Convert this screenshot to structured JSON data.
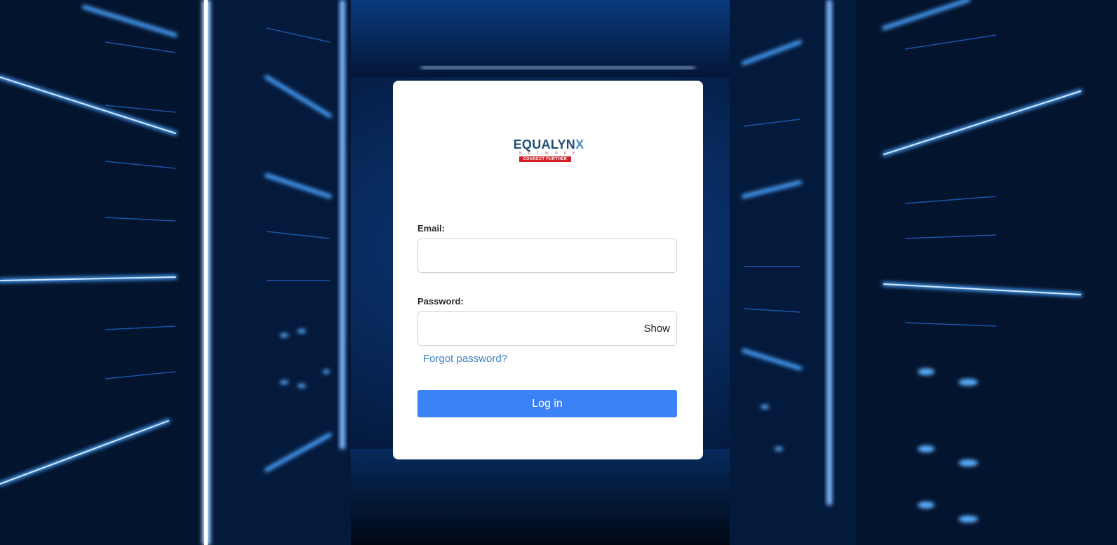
{
  "brand": {
    "name_main": "EQUALYN",
    "name_x": "X",
    "subline": "NETWORKS",
    "tagline": "CONNECT FURTHER"
  },
  "form": {
    "email_label": "Email:",
    "email_value": "",
    "email_placeholder": "",
    "password_label": "Password:",
    "password_value": "",
    "password_placeholder": "",
    "show_label": "Show",
    "forgot_label": "Forgot password?",
    "login_label": "Log in"
  },
  "colors": {
    "primary_button": "#3b82f6",
    "link": "#3b7ec9",
    "brand_blue": "#1d4e7a",
    "brand_red": "#d51f26"
  }
}
